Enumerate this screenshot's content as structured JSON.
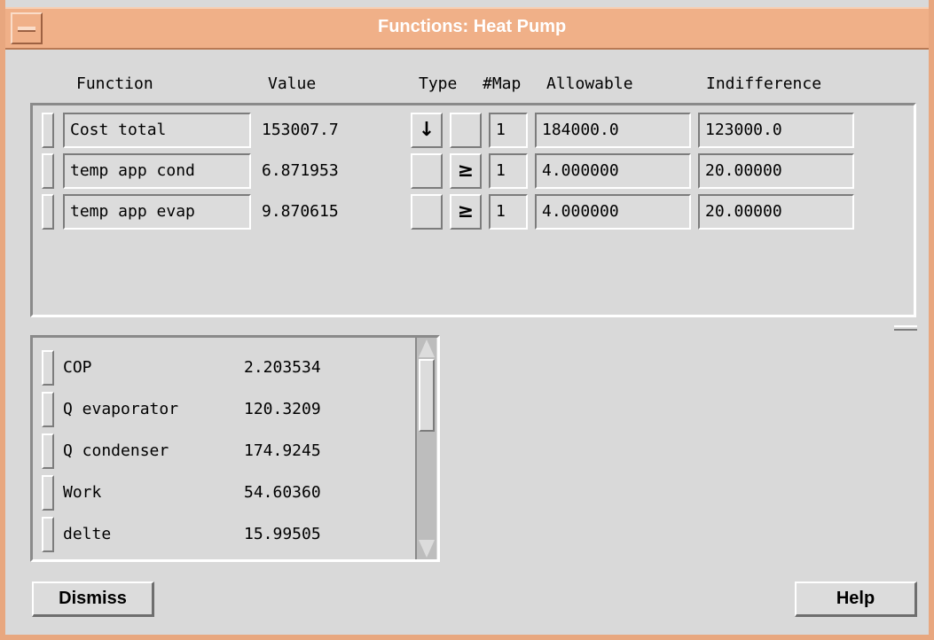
{
  "window": {
    "title": "Functions: Heat Pump"
  },
  "headers": {
    "function": "Function",
    "value": "Value",
    "type": "Type",
    "map": "#Map",
    "allowable": "Allowable",
    "indifference": "Indifference"
  },
  "functions": [
    {
      "name": "Cost total",
      "value": "153007.7",
      "type_min": "↓",
      "type_ge": "",
      "map": "1",
      "allowable": "184000.0",
      "indifference": "123000.0"
    },
    {
      "name": "temp app cond",
      "value": "6.871953",
      "type_min": "",
      "type_ge": "≥",
      "map": "1",
      "allowable": "4.000000",
      "indifference": "20.00000"
    },
    {
      "name": "temp app evap",
      "value": "9.870615",
      "type_min": "",
      "type_ge": "≥",
      "map": "1",
      "allowable": "4.000000",
      "indifference": "20.00000"
    }
  ],
  "variables": [
    {
      "name": "COP",
      "value": "2.203534"
    },
    {
      "name": "Q evaporator",
      "value": "120.3209"
    },
    {
      "name": "Q condenser",
      "value": "174.9245"
    },
    {
      "name": "Work",
      "value": "54.60360"
    },
    {
      "name": "delte",
      "value": "15.99505"
    }
  ],
  "buttons": {
    "dismiss": "Dismiss",
    "help": "Help"
  },
  "colors": {
    "titlebar": "#f0b088",
    "background": "#dcdcdc"
  }
}
